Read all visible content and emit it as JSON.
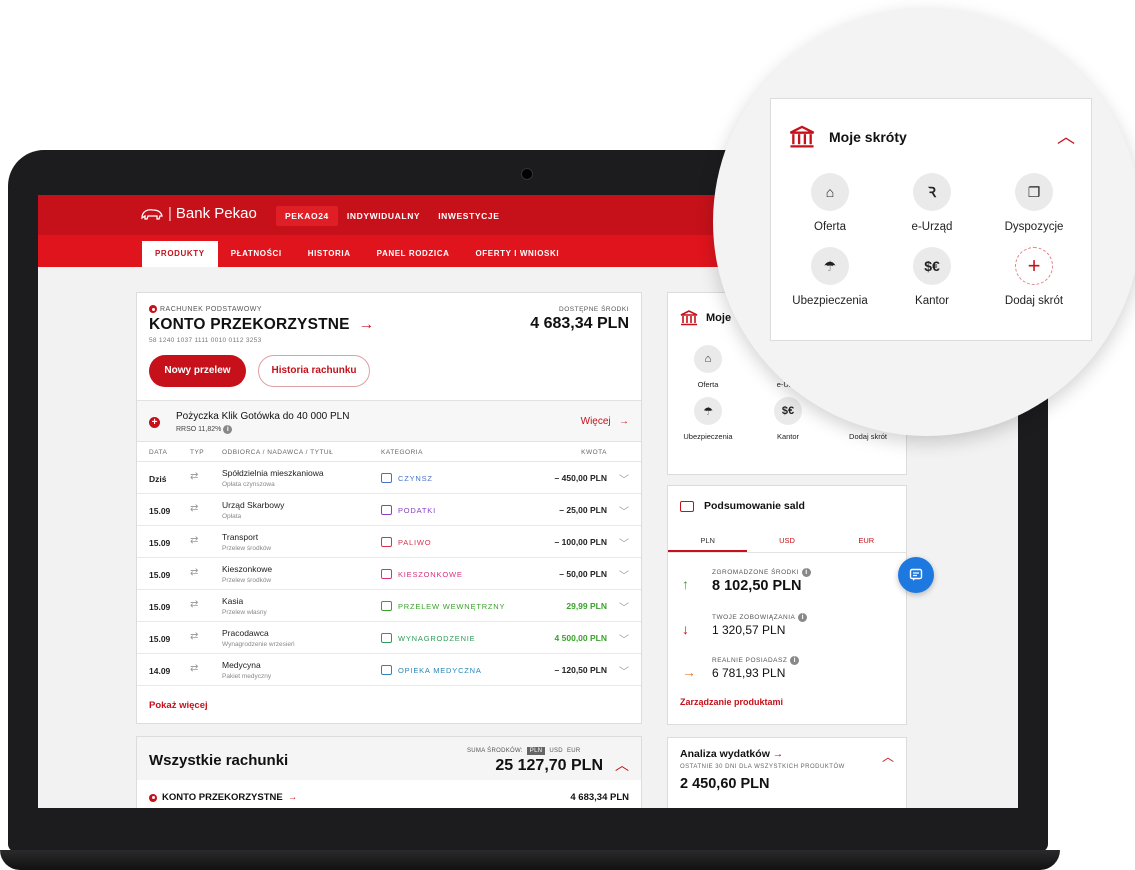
{
  "nav": {
    "brand": "Bank Pekao",
    "top_items": [
      {
        "label": "PEKAO24",
        "active": true
      },
      {
        "label": "INDYWIDUALNY",
        "active": false
      },
      {
        "label": "INWESTYCJE",
        "active": false
      }
    ],
    "sub_items": [
      {
        "label": "PRODUKTY",
        "active": true
      },
      {
        "label": "PŁATNOŚCI",
        "active": false
      },
      {
        "label": "HISTORIA",
        "active": false
      },
      {
        "label": "PANEL RODZICA",
        "active": false
      },
      {
        "label": "OFERTY I WNIOSKI",
        "active": false
      }
    ]
  },
  "account": {
    "type_label": "RACHUNEK PODSTAWOWY",
    "name": "KONTO PRZEKORZYSTNE",
    "number": "58 1240 1037 1111 0010 0112 3253",
    "available_label": "DOSTĘPNE ŚRODKI",
    "available_amount": "4 683,34 PLN",
    "new_transfer_label": "Nowy przelew",
    "history_label": "Historia rachunku"
  },
  "loan": {
    "title": "Pożyczka Klik Gotówka do 40 000 PLN",
    "rrso": "RRSO 11,82%",
    "more_label": "Więcej"
  },
  "transactions": {
    "headers": {
      "date": "DATA",
      "type": "TYP",
      "party": "ODBIORCA / NADAWCA / TYTUŁ",
      "category": "KATEGORIA",
      "amount": "KWOTA"
    },
    "rows": [
      {
        "date": "Dziś",
        "party": "Spółdzielnia mieszkaniowa",
        "title": "Opłata czynszowa",
        "category": "CZYNSZ",
        "category_color": "#4a6fc9",
        "amount": "– 450,00 PLN",
        "positive": false
      },
      {
        "date": "15.09",
        "party": "Urząd Skarbowy",
        "title": "Opłata",
        "category": "PODATKI",
        "category_color": "#8a3fc9",
        "amount": "– 25,00 PLN",
        "positive": false
      },
      {
        "date": "15.09",
        "party": "Transport",
        "title": "Przelew środków",
        "category": "PALIWO",
        "category_color": "#d9324a",
        "amount": "– 100,00 PLN",
        "positive": false
      },
      {
        "date": "15.09",
        "party": "Kieszonkowe",
        "title": "Przelew środków",
        "category": "KIESZONKOWE",
        "category_color": "#d9327a",
        "amount": "– 50,00 PLN",
        "positive": false
      },
      {
        "date": "15.09",
        "party": "Kasia",
        "title": "Przelew własny",
        "category": "PRZELEW WEWNĘTRZNY",
        "category_color": "#3aa22b",
        "amount": "29,99 PLN",
        "positive": true
      },
      {
        "date": "15.09",
        "party": "Pracodawca",
        "title": "Wynagrodzenie wrzesień",
        "category": "WYNAGRODZENIE",
        "category_color": "#2e9a58",
        "amount": "4 500,00 PLN",
        "positive": true
      },
      {
        "date": "14.09",
        "party": "Medycyna",
        "title": "Pakiet medyczny",
        "category": "OPIEKA MEDYCZNA",
        "category_color": "#2a86b8",
        "amount": "– 120,50 PLN",
        "positive": false
      }
    ],
    "show_more_label": "Pokaż więcej"
  },
  "all_accounts": {
    "title": "Wszystkie rachunki",
    "sum_label": "SUMA ŚRODKÓW:",
    "currencies": [
      "PLN",
      "USD",
      "EUR"
    ],
    "sum_amount": "25 127,70 PLN",
    "first_account": "KONTO PRZEKORZYSTNE",
    "first_amount": "4 683,34 PLN"
  },
  "shortcuts": {
    "title": "Moje skróty",
    "small_title": "Moje",
    "items": [
      {
        "label": "Oferta",
        "icon": "bag-icon",
        "glyph": "⌂"
      },
      {
        "label": "e-Urząd",
        "icon": "people-icon",
        "glyph": "Ꝛ"
      },
      {
        "label": "Dyspozycje",
        "icon": "copy-icon",
        "glyph": "❐"
      },
      {
        "label": "Ubezpieczenia",
        "icon": "umbrella-icon",
        "glyph": "☂"
      },
      {
        "label": "Kantor",
        "icon": "exchange-icon",
        "glyph": "$€"
      },
      {
        "label": "Dodaj skrót",
        "icon": "add-icon",
        "glyph": "+"
      }
    ],
    "small_labels": [
      "Oferta",
      "e-Urzą",
      "",
      "Ubezpieczenia",
      "Kantor",
      "Dodaj skrót"
    ]
  },
  "balance": {
    "title": "Podsumowanie sald",
    "tabs": [
      "PLN",
      "USD",
      "EUR"
    ],
    "accumulated_label": "ZGROMADZONE ŚRODKI",
    "accumulated_value": "8 102,50 PLN",
    "liabilities_label": "TWOJE ZOBOWIĄZANIA",
    "liabilities_value": "1 320,57 PLN",
    "real_label": "REALNIE POSIADASZ",
    "real_value": "6 781,93 PLN",
    "manage_label": "Zarządzanie produktami",
    "colors": {
      "up": "#3aa22b",
      "down": "#c6111a",
      "neutral": "#e8762b"
    }
  },
  "expenses": {
    "title": "Analiza wydatków",
    "subtitle": "OSTATNIE 30 DNI DLA WSZYSTKICH PRODUKTÓW",
    "amount": "2 450,60 PLN"
  },
  "colors": {
    "brand": "#c6111a",
    "accent": "#e0141c",
    "chat": "#1d78e0"
  }
}
